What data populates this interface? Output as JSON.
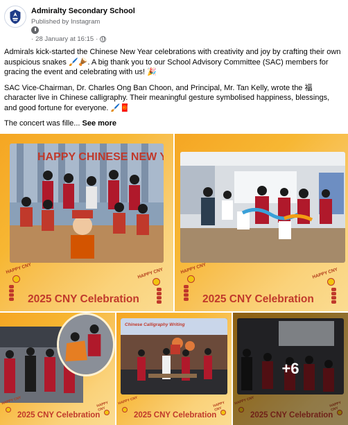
{
  "post": {
    "page_name": "Admiralty Secondary School",
    "publisher": "Published by Instagram",
    "date": "28 January at 16:15",
    "separator": "·",
    "paragraphs": [
      "Admirals kick-started the Chinese New Year celebrations with creativity and joy by crafting their own auspicious snakes 🖌️🪘. A big thank you to our School Advisory Committee (SAC) members for gracing the event and celebrating with us! 🎉",
      "SAC Vice-Chairman, Dr. Charles Ong Ban Choon, and Principal, Mr. Tan Kelly, wrote the 福 character live in Chinese calligraphy. Their meaningful gesture symbolised happiness, blessings, and good fortune for everyone. 🖌️🧧"
    ],
    "truncated_text": "The concert was fille...",
    "see_more_label": "See more"
  },
  "icons": {
    "avatar": "school-crest-icon",
    "pin": "map-pin-icon",
    "audience": "globe-icon",
    "decoration_coin": "gold-coin-icon",
    "decoration_firecracker": "firecracker-icon"
  },
  "tiles": [
    {
      "caption": "2025 CNY Celebration",
      "happy_cny_left": "HAPPY CNY",
      "happy_cny_right": "HAPPY CNY",
      "banner_text": "HAPPY CHINESE NEW YEAR"
    },
    {
      "caption": "2025 CNY Celebration",
      "happy_cny_left": "HAPPY CNY",
      "happy_cny_right": "HAPPY CNY"
    },
    {
      "caption": "2025 CNY Celebration",
      "happy_cny_left": "HAPPY CNY",
      "happy_cny_right": "HAPPY CNY"
    },
    {
      "caption": "2025 CNY Celebration",
      "happy_cny_left": "HAPPY CNY",
      "happy_cny_right": "HAPPY CNY",
      "board_text": "Chinese Calligraphy Writing"
    },
    {
      "caption": "2025 CNY Celebration",
      "happy_cny_left": "HAPPY CNY",
      "happy_cny_right": "HAPPY CNY",
      "more_count": "+6"
    }
  ],
  "colors": {
    "caption": "#c0392b",
    "frame_gradient_start": "#f5a623",
    "frame_gradient_end": "#fbdc92",
    "meta_text": "#65676b"
  }
}
